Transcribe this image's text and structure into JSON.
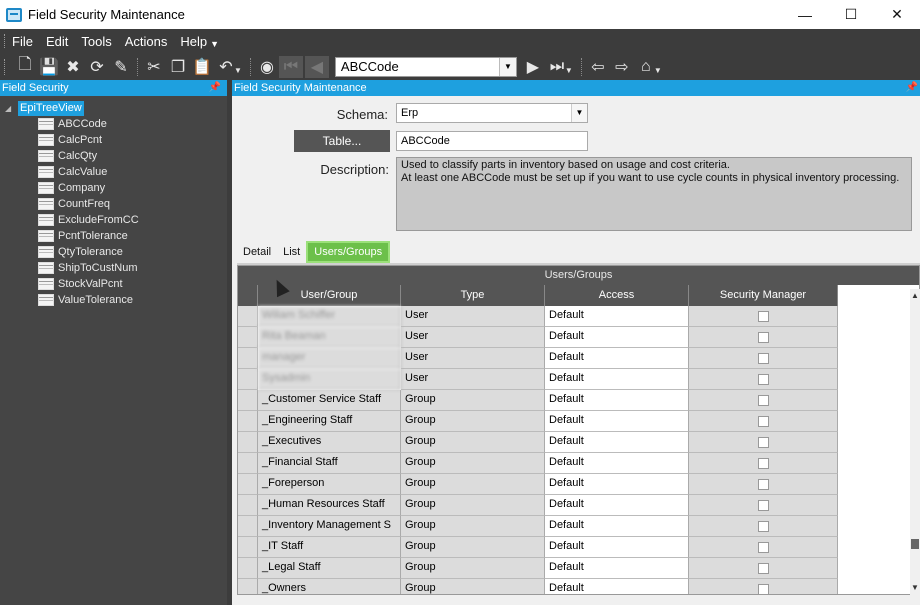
{
  "window": {
    "title": "Field Security Maintenance",
    "controls": [
      "minimize-icon",
      "maximize-icon",
      "close-icon"
    ]
  },
  "menu": {
    "items": [
      "File",
      "Edit",
      "Tools",
      "Actions",
      "Help"
    ]
  },
  "toolbar": {
    "navigator_value": "ABCCode"
  },
  "left_panel": {
    "title": "Field Security",
    "root": "EpiTreeView",
    "items": [
      "ABCCode",
      "CalcPcnt",
      "CalcQty",
      "CalcValue",
      "Company",
      "CountFreq",
      "ExcludeFromCC",
      "PcntTolerance",
      "QtyTolerance",
      "ShipToCustNum",
      "StockValPcnt",
      "ValueTolerance"
    ]
  },
  "main": {
    "title": "Field Security Maintenance",
    "schema_label": "Schema:",
    "schema_value": "Erp",
    "table_button": "Table...",
    "table_value": "ABCCode",
    "description_label": "Description:",
    "description": "Used to classify parts in inventory based on usage and cost criteria.\nAt least one ABCCode must be set up if you want to use cycle counts in physical inventory processing.",
    "tabs": [
      "Detail",
      "List",
      "Users/Groups"
    ],
    "active_tab": "Users/Groups"
  },
  "grid": {
    "caption": "Users/Groups",
    "columns": [
      "User/Group",
      "Type",
      "Access",
      "Security Manager"
    ],
    "rows": [
      {
        "name": "Wiliam Schiffer",
        "type": "User",
        "access": "Default",
        "blurred": true
      },
      {
        "name": "Rita Beaman",
        "type": "User",
        "access": "Default",
        "blurred": true
      },
      {
        "name": "manager",
        "type": "User",
        "access": "Default",
        "blurred": true
      },
      {
        "name": "Sysadmin",
        "type": "User",
        "access": "Default",
        "blurred": true
      },
      {
        "name": "_Customer Service Staff",
        "type": "Group",
        "access": "Default"
      },
      {
        "name": "_Engineering Staff",
        "type": "Group",
        "access": "Default"
      },
      {
        "name": "_Executives",
        "type": "Group",
        "access": "Default"
      },
      {
        "name": "_Financial Staff",
        "type": "Group",
        "access": "Default"
      },
      {
        "name": "_Foreperson",
        "type": "Group",
        "access": "Default"
      },
      {
        "name": "_Human Resources Staff",
        "type": "Group",
        "access": "Default"
      },
      {
        "name": "_Inventory Management S",
        "type": "Group",
        "access": "Default"
      },
      {
        "name": "_IT Staff",
        "type": "Group",
        "access": "Default"
      },
      {
        "name": "_Legal Staff",
        "type": "Group",
        "access": "Default"
      },
      {
        "name": "_Owners",
        "type": "Group",
        "access": "Default"
      }
    ]
  }
}
